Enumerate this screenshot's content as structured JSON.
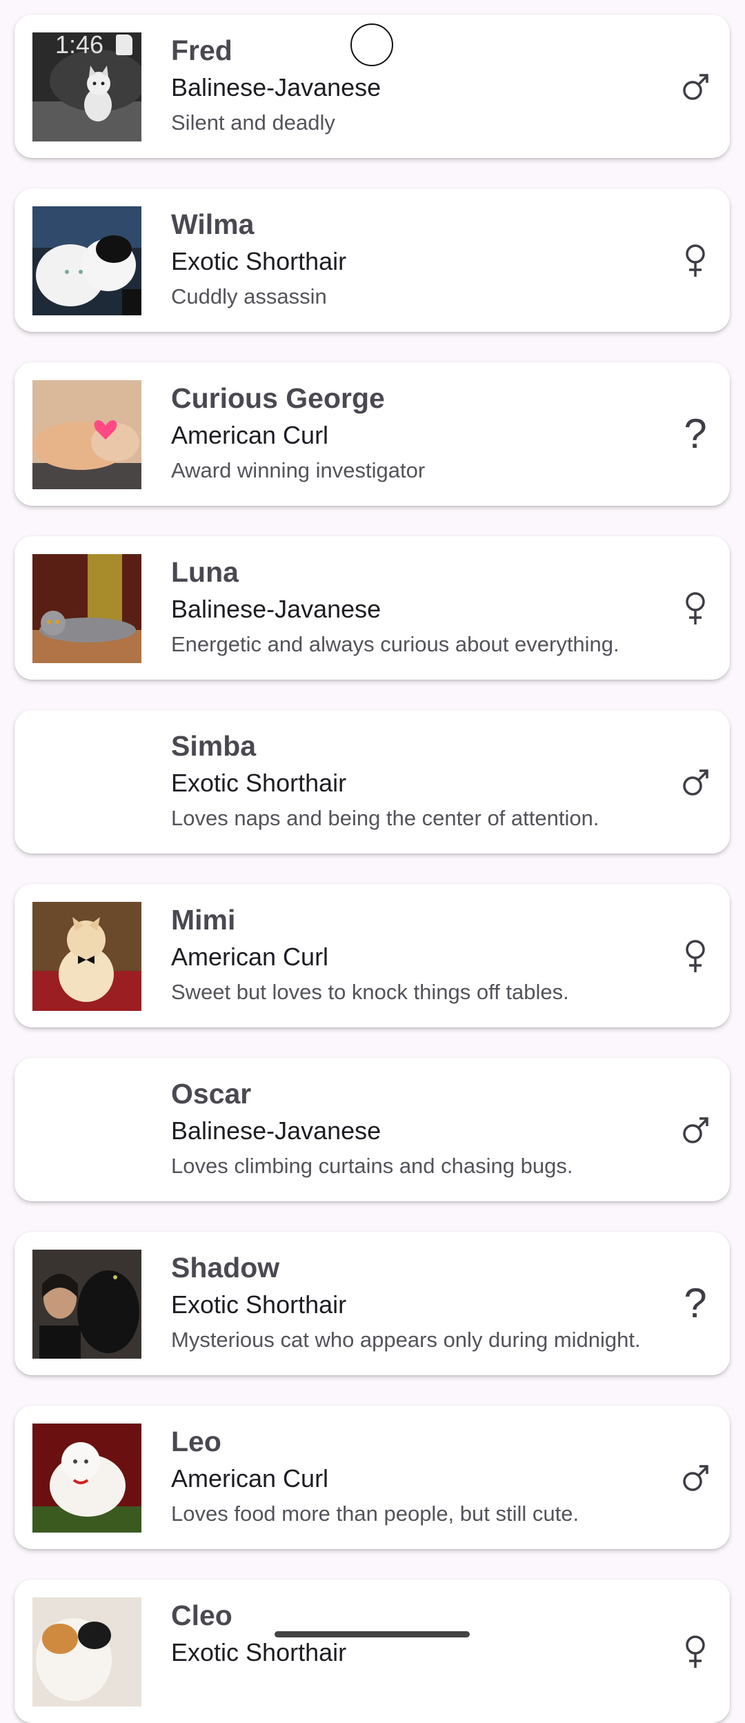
{
  "status": {
    "time": "1:46"
  },
  "cats": [
    {
      "name": "Fred",
      "breed": "Balinese-Javanese",
      "description": "Silent and deadly",
      "gender": "male",
      "photo": "grey-kitten"
    },
    {
      "name": "Wilma",
      "breed": "Exotic Shorthair",
      "description": "Cuddly assassin",
      "gender": "female",
      "photo": "white-cats"
    },
    {
      "name": "Curious George",
      "breed": "American Curl",
      "description": "Award winning investigator",
      "gender": "unknown",
      "photo": "sleeping-cat-heart"
    },
    {
      "name": "Luna",
      "breed": "Balinese-Javanese",
      "description": "Energetic and always curious about everything.",
      "gender": "female",
      "photo": "grey-cat-lying"
    },
    {
      "name": "Simba",
      "breed": "Exotic Shorthair",
      "description": "Loves naps and being the center of attention.",
      "gender": "male",
      "photo": ""
    },
    {
      "name": "Mimi",
      "breed": "American Curl",
      "description": "Sweet but loves to knock things off tables.",
      "gender": "female",
      "photo": "cream-cat-bowtie"
    },
    {
      "name": "Oscar",
      "breed": "Balinese-Javanese",
      "description": "Loves climbing curtains and chasing bugs.",
      "gender": "male",
      "photo": ""
    },
    {
      "name": "Shadow",
      "breed": "Exotic Shorthair",
      "description": "Mysterious cat who appears only during midnight.",
      "gender": "unknown",
      "photo": "black-cat-person"
    },
    {
      "name": "Leo",
      "breed": "American Curl",
      "description": "Loves food more than people, but still cute.",
      "gender": "male",
      "photo": "white-persian"
    },
    {
      "name": "Cleo",
      "breed": "Exotic Shorthair",
      "description": "",
      "gender": "female",
      "photo": "calico-cat"
    }
  ],
  "colors": {
    "background": "#fbf7fc",
    "card": "#ffffff",
    "name_text": "#4a4850",
    "icon": "#3e3c44"
  }
}
